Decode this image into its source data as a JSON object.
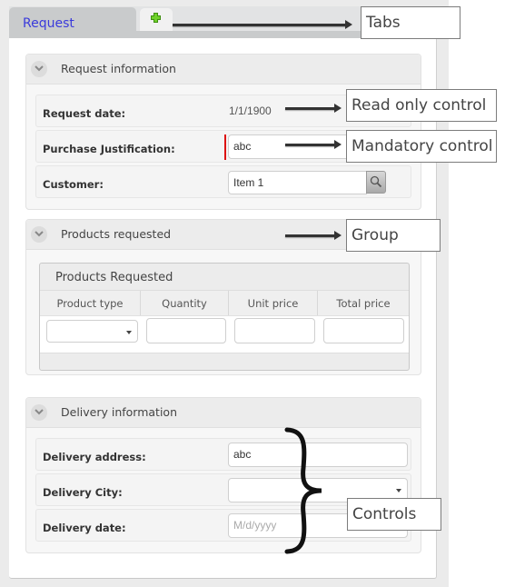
{
  "tabs": [
    {
      "label": "Request",
      "active": true
    },
    {
      "label": "+",
      "icon": "add-tab-icon"
    }
  ],
  "groups": {
    "request_info": {
      "title": "Request information",
      "fields": {
        "request_date": {
          "label": "Request date:",
          "value": "1/1/1900"
        },
        "purchase_justification": {
          "label": "Purchase Justification:",
          "value": "abc"
        },
        "customer": {
          "label": "Customer:",
          "value": "Item 1"
        }
      }
    },
    "products": {
      "title": "Products requested",
      "grid": {
        "title": "Products Requested",
        "columns": [
          "Product type",
          "Quantity",
          "Unit price",
          "Total price"
        ]
      }
    },
    "delivery": {
      "title": "Delivery information",
      "fields": {
        "address": {
          "label": "Delivery address:",
          "value": "abc"
        },
        "city": {
          "label": "Delivery City:",
          "value": ""
        },
        "date": {
          "label": "Delivery date:",
          "placeholder": "M/d/yyyy"
        }
      }
    }
  },
  "annotations": {
    "tabs": "Tabs",
    "read_only": "Read only control",
    "mandatory": "Mandatory control",
    "group": "Group",
    "controls": "Controls"
  },
  "colors": {
    "tab_text": "#3a3adb",
    "mandatory_marker": "#dd1111",
    "add_icon": "#66cc00"
  }
}
